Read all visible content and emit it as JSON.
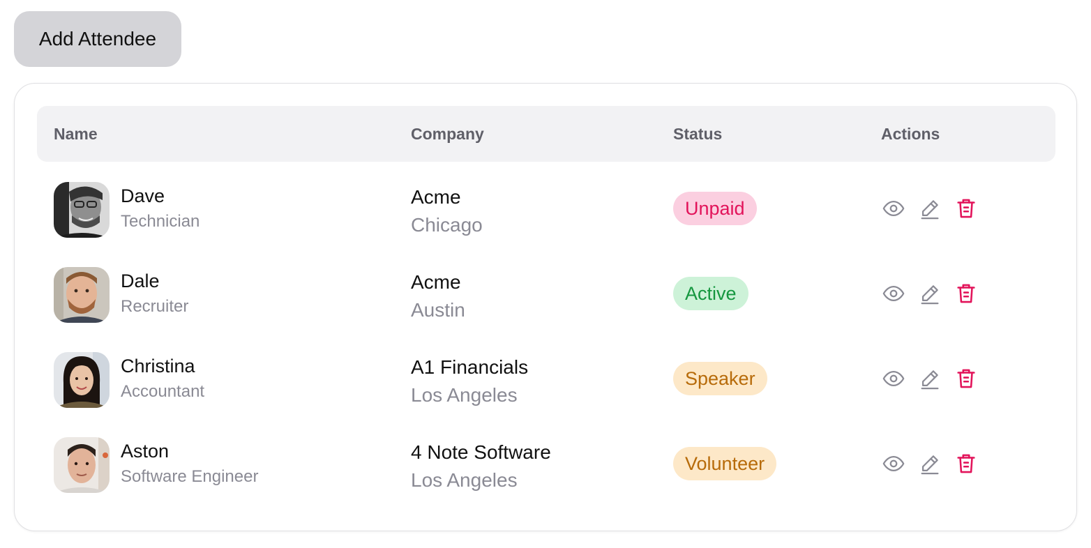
{
  "toolbar": {
    "add_label": "Add Attendee"
  },
  "table": {
    "headers": {
      "name": "Name",
      "company": "Company",
      "status": "Status",
      "actions": "Actions"
    },
    "rows": [
      {
        "name": "Dave",
        "role": "Technician",
        "company": "Acme",
        "city": "Chicago",
        "status": "Unpaid"
      },
      {
        "name": "Dale",
        "role": "Recruiter",
        "company": "Acme",
        "city": "Austin",
        "status": "Active"
      },
      {
        "name": "Christina",
        "role": "Accountant",
        "company": "A1 Financials",
        "city": "Los Angeles",
        "status": "Speaker"
      },
      {
        "name": "Aston",
        "role": "Software Engineer",
        "company": "4 Note Software",
        "city": "Los Angeles",
        "status": "Volunteer"
      }
    ]
  },
  "status_styles": {
    "Unpaid": {
      "bg": "#fbcfe0",
      "fg": "#e2135a"
    },
    "Active": {
      "bg": "#cdf2d8",
      "fg": "#15973f"
    },
    "Speaker": {
      "bg": "#fde8c8",
      "fg": "#b76b0a"
    },
    "Volunteer": {
      "bg": "#fde8c8",
      "fg": "#b76b0a"
    }
  },
  "action_icons": [
    "eye-icon",
    "pencil-icon",
    "trash-icon"
  ],
  "colors": {
    "icon_gray": "#8a8a94",
    "delete_red": "#e2135a"
  }
}
